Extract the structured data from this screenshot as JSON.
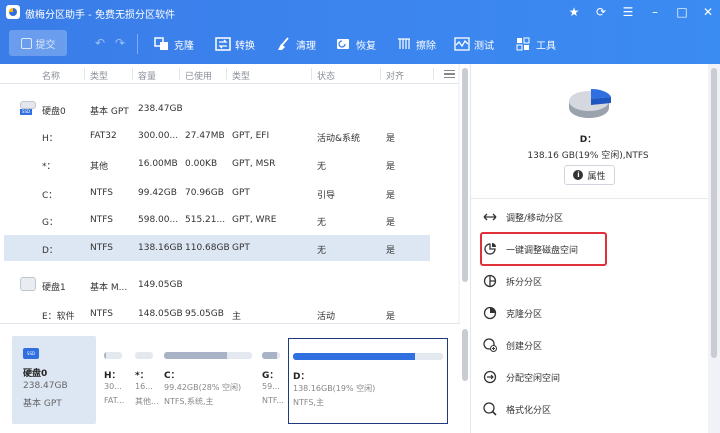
{
  "app": {
    "title": "傲梅分区助手 - 免费无损分区软件"
  },
  "toolbar": {
    "commit_label": "提交",
    "tools": [
      {
        "label": "克隆",
        "icon": "clone-icon"
      },
      {
        "label": "转换",
        "icon": "convert-icon"
      },
      {
        "label": "清理",
        "icon": "clean-icon"
      },
      {
        "label": "恢复",
        "icon": "recover-icon"
      },
      {
        "label": "擦除",
        "icon": "wipe-icon"
      },
      {
        "label": "测试",
        "icon": "test-icon"
      },
      {
        "label": "工具",
        "icon": "tools-icon"
      }
    ]
  },
  "table": {
    "headers": [
      "名称",
      "类型",
      "容量",
      "已使用",
      "类型",
      "状态",
      "对齐"
    ],
    "rows": [
      {
        "kind": "disk",
        "name": "硬盘0",
        "type": "基本 GPT",
        "capacity": "238.47GB"
      },
      {
        "kind": "part",
        "name": "H：",
        "type": "FAT32",
        "capacity": "300.00...",
        "used": "27.47MB",
        "ptype": "GPT, EFI",
        "status": "活动&系统",
        "align": "是"
      },
      {
        "kind": "part",
        "name": "*：",
        "type": "其他",
        "capacity": "16.00MB",
        "used": "0.00KB",
        "ptype": "GPT, MSR",
        "status": "无",
        "align": "是"
      },
      {
        "kind": "part",
        "name": "C：",
        "type": "NTFS",
        "capacity": "99.42GB",
        "used": "70.96GB",
        "ptype": "GPT",
        "status": "引导",
        "align": "是"
      },
      {
        "kind": "part",
        "name": "G：",
        "type": "NTFS",
        "capacity": "598.00...",
        "used": "515.21...",
        "ptype": "GPT, WRE",
        "status": "无",
        "align": "是"
      },
      {
        "kind": "part",
        "name": "D：",
        "type": "NTFS",
        "capacity": "138.16GB",
        "used": "110.68GB",
        "ptype": "GPT",
        "status": "无",
        "align": "是",
        "selected": true
      },
      {
        "kind": "disk",
        "name": "硬盘1",
        "type": "基本 M...",
        "capacity": "149.05GB"
      },
      {
        "kind": "part",
        "name": "E：软件",
        "type": "NTFS",
        "capacity": "148.05GB",
        "used": "95.05GB",
        "ptype": "主",
        "status": "活动",
        "align": "是"
      }
    ]
  },
  "diskmap": {
    "disk": {
      "name": "硬盘0",
      "size": "238.47GB",
      "type": "基本 GPT",
      "badge": "SSD"
    },
    "partitions": [
      {
        "l1": "H：",
        "l2": "30...",
        "l3": "FAT...",
        "fill": 0.1
      },
      {
        "l1": "*：",
        "l2": "16...",
        "l3": "其他...",
        "fill": 0.0
      },
      {
        "l1": "C：",
        "l2": "99.42GB(28% 空闲)",
        "l3": "NTFS,系统,主",
        "fill": 0.72
      },
      {
        "l1": "G：",
        "l2": "59...",
        "l3": "NTF...",
        "fill": 0.86
      },
      {
        "l1": "D：",
        "l2": "138.16GB(19% 空闲)",
        "l3": "NTFS,主",
        "fill": 0.81,
        "selected": true
      }
    ]
  },
  "details": {
    "drive_name": "D：",
    "drive_info": "138.16 GB(19% 空闲),NTFS",
    "properties_label": "属性",
    "operations": [
      {
        "label": "调整/移动分区",
        "icon": "resize-move-icon"
      },
      {
        "label": "一键调整磁盘空间",
        "icon": "one-click-adjust-icon",
        "highlighted": true
      },
      {
        "label": "拆分分区",
        "icon": "split-partition-icon"
      },
      {
        "label": "克隆分区",
        "icon": "clone-partition-icon"
      },
      {
        "label": "创建分区",
        "icon": "create-partition-icon"
      },
      {
        "label": "分配空闲空间",
        "icon": "allocate-space-icon"
      },
      {
        "label": "格式化分区",
        "icon": "format-partition-icon"
      }
    ]
  },
  "colors": {
    "accent": "#2f6fe0",
    "toolbar": "#3b82ee",
    "selected_row": "#dde7f4",
    "highlight": "#e0303a"
  }
}
